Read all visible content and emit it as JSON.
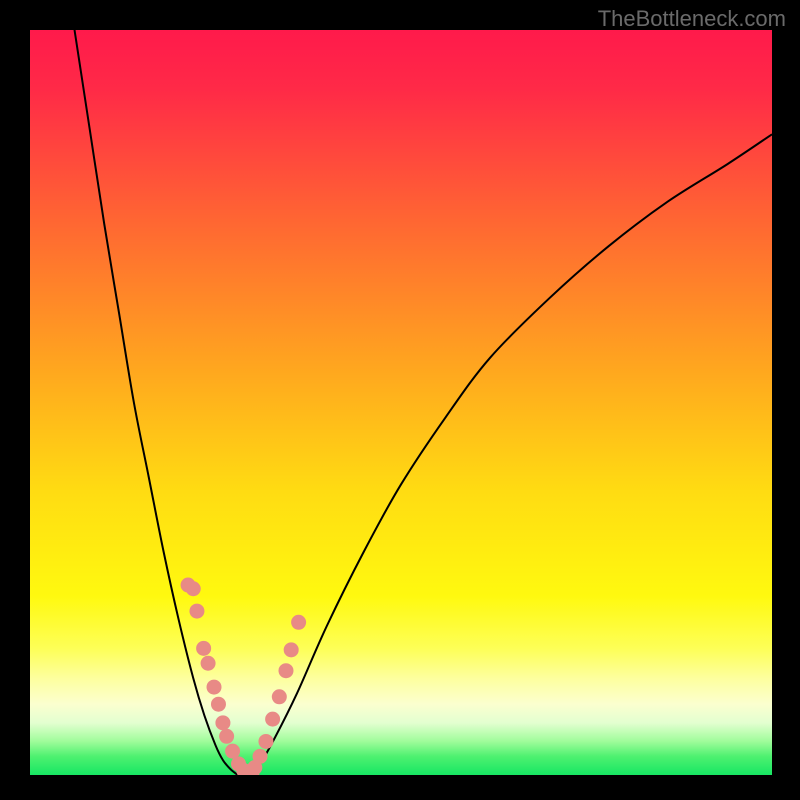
{
  "watermark": "TheBottleneck.com",
  "chart_data": {
    "type": "line",
    "title": "",
    "xlabel": "",
    "ylabel": "",
    "xlim": [
      0,
      100
    ],
    "ylim": [
      0,
      100
    ],
    "grid": false,
    "annotations": [],
    "gradient_stops": [
      {
        "offset": 0.0,
        "color": "#ff1a4b"
      },
      {
        "offset": 0.08,
        "color": "#ff2a47"
      },
      {
        "offset": 0.25,
        "color": "#ff6433"
      },
      {
        "offset": 0.45,
        "color": "#ffa51f"
      },
      {
        "offset": 0.62,
        "color": "#ffdc12"
      },
      {
        "offset": 0.76,
        "color": "#fff90f"
      },
      {
        "offset": 0.83,
        "color": "#fdff57"
      },
      {
        "offset": 0.87,
        "color": "#fdff9e"
      },
      {
        "offset": 0.905,
        "color": "#fbffcf"
      },
      {
        "offset": 0.93,
        "color": "#e3ffd0"
      },
      {
        "offset": 0.955,
        "color": "#9ffc9a"
      },
      {
        "offset": 0.975,
        "color": "#4ef170"
      },
      {
        "offset": 1.0,
        "color": "#17e663"
      }
    ],
    "series": [
      {
        "name": "left-curve",
        "type": "line",
        "color": "#000000",
        "x": [
          6,
          8,
          10,
          12,
          14,
          16,
          18,
          20,
          22,
          23.5,
          25,
          26,
          27,
          28
        ],
        "y": [
          100,
          87,
          74,
          62,
          50,
          40,
          30,
          21,
          13,
          8,
          4,
          2,
          0.8,
          0
        ]
      },
      {
        "name": "right-curve",
        "type": "line",
        "color": "#000000",
        "x": [
          29.5,
          31,
          33,
          36,
          40,
          45,
          50,
          56,
          62,
          70,
          78,
          86,
          94,
          100
        ],
        "y": [
          0,
          1.5,
          5,
          11,
          20,
          30,
          39,
          48,
          56,
          64,
          71,
          77,
          82,
          86
        ]
      },
      {
        "name": "left-scatter",
        "type": "scatter",
        "color": "#e88a86",
        "x": [
          21.3,
          22.0,
          22.5,
          23.4,
          24.0,
          24.8,
          25.4,
          26.0,
          26.5,
          27.3,
          28.1,
          28.8,
          29.2
        ],
        "y": [
          25.5,
          25.0,
          22.0,
          17.0,
          15.0,
          11.8,
          9.5,
          7.0,
          5.2,
          3.2,
          1.5,
          0.6,
          0.1
        ]
      },
      {
        "name": "right-scatter",
        "type": "scatter",
        "color": "#e88a86",
        "x": [
          30.3,
          31.0,
          31.8,
          32.7,
          33.6,
          34.5,
          35.2,
          36.2
        ],
        "y": [
          1.0,
          2.5,
          4.5,
          7.5,
          10.5,
          14.0,
          16.8,
          20.5
        ]
      },
      {
        "name": "bottom-scatter",
        "type": "scatter",
        "color": "#e88a86",
        "x": [
          29.0,
          29.6,
          29.9
        ],
        "y": [
          0.0,
          0.0,
          0.2
        ]
      }
    ]
  }
}
